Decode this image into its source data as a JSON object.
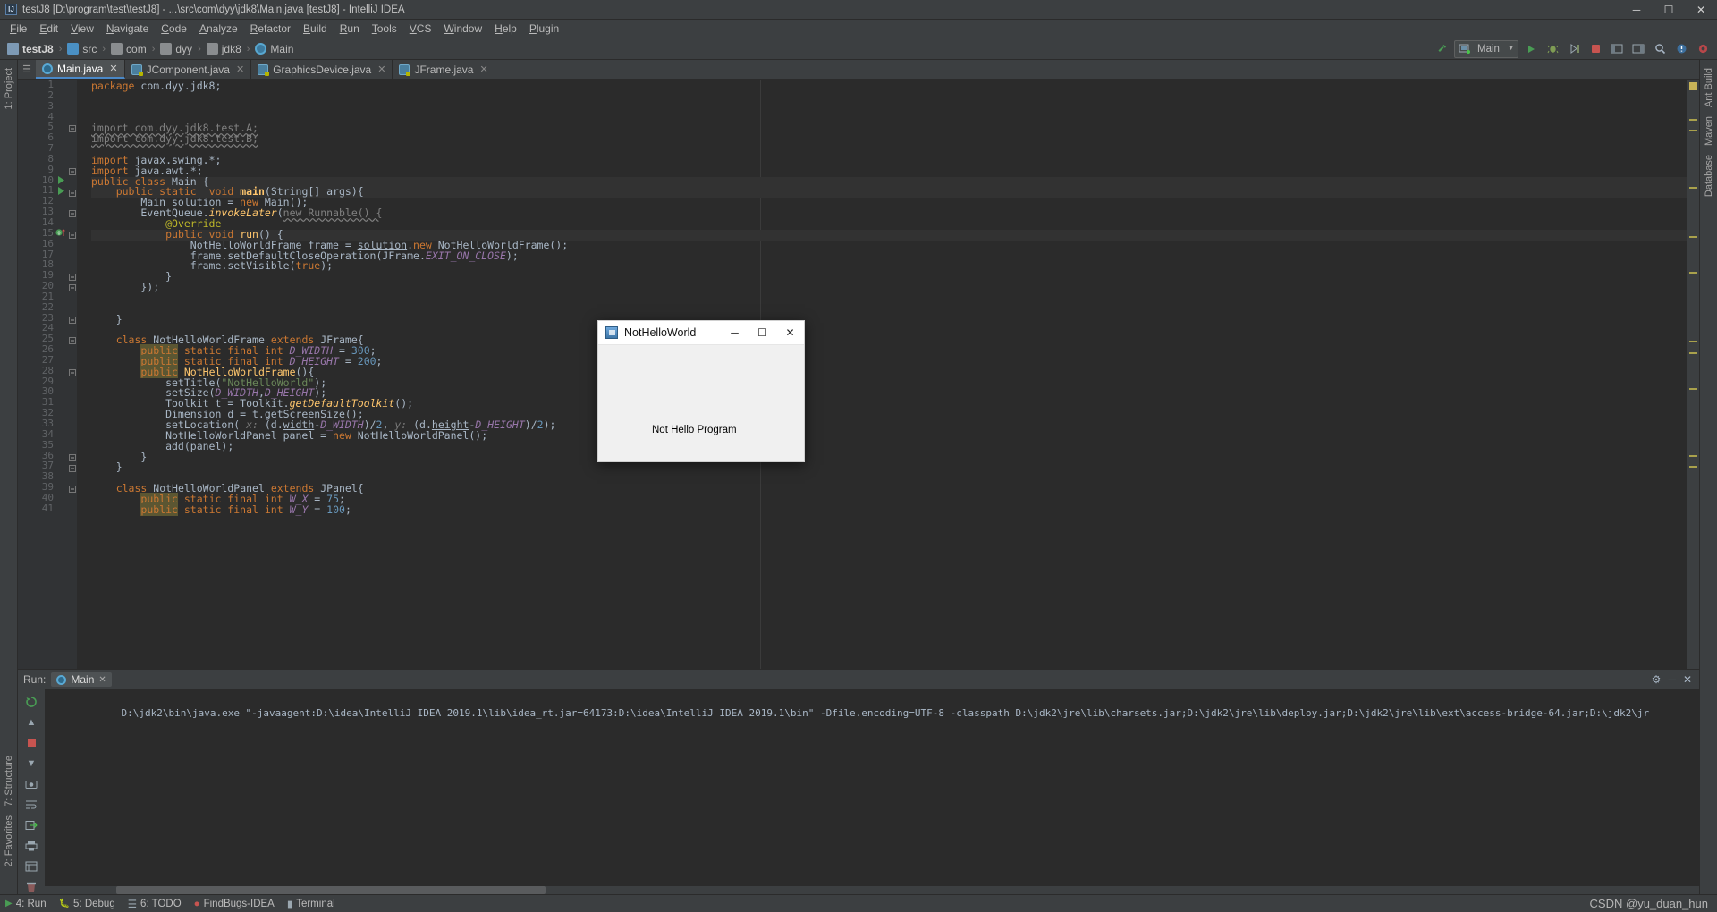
{
  "window": {
    "title": "testJ8 [D:\\program\\test\\testJ8] - ...\\src\\com\\dyy\\jdk8\\Main.java [testJ8] - IntelliJ IDEA",
    "logo": "IJ",
    "minimize": "─",
    "maximize": "☐",
    "close": "✕"
  },
  "menu": [
    "File",
    "Edit",
    "View",
    "Navigate",
    "Code",
    "Analyze",
    "Refactor",
    "Build",
    "Run",
    "Tools",
    "VCS",
    "Window",
    "Help",
    "Plugin"
  ],
  "breadcrumb": [
    {
      "label": "testJ8",
      "icon": "module-icon",
      "bold": true
    },
    {
      "label": "src",
      "icon": "source-folder-icon",
      "bold": false
    },
    {
      "label": "com",
      "icon": "folder-icon",
      "bold": false
    },
    {
      "label": "dyy",
      "icon": "folder-icon",
      "bold": false
    },
    {
      "label": "jdk8",
      "icon": "folder-icon",
      "bold": false
    },
    {
      "label": "Main",
      "icon": "class-icon",
      "bold": false
    }
  ],
  "toolbar": {
    "build_icon": "hammer-icon",
    "run_config": "Main",
    "dropdown_arrow": "▼",
    "run_icon": "▶",
    "debug_icon": "debug-icon",
    "coverage_icon": "coverage-icon",
    "stop_icon": "stop-icon",
    "layout_icon": "layout-icon",
    "updates_icon": "updates-icon",
    "search_icon": "⌕",
    "settings_icon": "⚙"
  },
  "tabs": [
    {
      "label": "Main.java",
      "icon": "java-class-icon",
      "active": true
    },
    {
      "label": "JComponent.java",
      "icon": "java-library-class-icon",
      "active": false
    },
    {
      "label": "GraphicsDevice.java",
      "icon": "java-library-class-icon",
      "active": false
    },
    {
      "label": "JFrame.java",
      "icon": "java-library-class-icon",
      "active": false
    }
  ],
  "left_tool_strip": [
    {
      "label": "1: Project",
      "name": "tool-window-project"
    },
    {
      "label": "7: Structure",
      "name": "tool-window-structure"
    },
    {
      "label": "2: Favorites",
      "name": "tool-window-favorites"
    }
  ],
  "right_tool_strip": [
    {
      "label": "Ant Build",
      "name": "tool-window-ant-build"
    },
    {
      "label": "Maven",
      "name": "tool-window-maven"
    },
    {
      "label": "Database",
      "name": "tool-window-database"
    }
  ],
  "editor": {
    "first_line": 1,
    "total_displayed_lines": 41,
    "code_lines": [
      {
        "n": 1,
        "html": "<span class=\"kw\">package</span> com.dyy.jdk8;"
      },
      {
        "n": 2,
        "html": ""
      },
      {
        "n": 3,
        "html": ""
      },
      {
        "n": 4,
        "html": ""
      },
      {
        "n": 5,
        "html": "<span class=\"err\">import com.dyy.jdk8.test.A;</span>"
      },
      {
        "n": 6,
        "html": "<span class=\"err\">import com.dyy.jdk8.test.B;</span>"
      },
      {
        "n": 7,
        "html": ""
      },
      {
        "n": 8,
        "html": "<span class=\"kw\">import</span> javax.swing.*;"
      },
      {
        "n": 9,
        "html": "<span class=\"kw\">import</span> java.awt.*;"
      },
      {
        "n": 10,
        "html": "<span class=\"kw\">public class</span> <span class=\"cls\">Main</span> {"
      },
      {
        "n": 11,
        "html": "    <span class=\"kw\">public static</span>  <span class=\"kw\">void</span> <span class=\"mth bold\">main</span>(String[] args){"
      },
      {
        "n": 12,
        "html": "        Main solution = <span class=\"kw\">new</span> Main();"
      },
      {
        "n": 13,
        "html": "        EventQueue.<span class=\"mthi\">invokeLater</span>(<span class=\"err\">new Runnable() {</span>"
      },
      {
        "n": 14,
        "html": "            <span class=\"anno\">@Override</span>"
      },
      {
        "n": 15,
        "html": "            <span class=\"kw\">public void</span> <span class=\"mth\">run</span>() {"
      },
      {
        "n": 16,
        "html": "                NotHelloWorldFrame frame = <span class=\"varu\">solution</span>.<span class=\"kw\">new</span> NotHelloWorldFrame();"
      },
      {
        "n": 17,
        "html": "                frame.setDefaultCloseOperation(JFrame.<span class=\"sfld\">EXIT_ON_CLOSE</span>);"
      },
      {
        "n": 18,
        "html": "                frame.setVisible(<span class=\"kw\">true</span>);"
      },
      {
        "n": 19,
        "html": "            }"
      },
      {
        "n": 20,
        "html": "        });"
      },
      {
        "n": 21,
        "html": ""
      },
      {
        "n": 22,
        "html": ""
      },
      {
        "n": 23,
        "html": "    }"
      },
      {
        "n": 24,
        "html": ""
      },
      {
        "n": 25,
        "html": "    <span class=\"kw\">class</span> <span class=\"cls\">NotHelloWorldFrame</span> <span class=\"kw\">extends</span> JFrame{"
      },
      {
        "n": 26,
        "html": "        <span class=\"kw hili\">public</span> <span class=\"kw\">static final int</span> <span class=\"sfld\">D_WIDTH</span> = <span class=\"num\">300</span>;"
      },
      {
        "n": 27,
        "html": "        <span class=\"kw hili\">public</span> <span class=\"kw\">static final int</span> <span class=\"sfld\">D_HEIGHT</span> = <span class=\"num\">200</span>;"
      },
      {
        "n": 28,
        "html": "        <span class=\"kw hili\">public</span> <span class=\"mth\">NotHelloWorldFrame</span>(){"
      },
      {
        "n": 29,
        "html": "            setTitle(<span class=\"str\">\"NotHelloWorld\"</span>);"
      },
      {
        "n": 30,
        "html": "            setSize(<span class=\"sfld\">D_WIDTH</span>,<span class=\"sfld\">D_HEIGHT</span>);"
      },
      {
        "n": 31,
        "html": "            Toolkit t = Toolkit.<span class=\"mthi\">getDefaultToolkit</span>();"
      },
      {
        "n": 32,
        "html": "            Dimension d = t.getScreenSize();"
      },
      {
        "n": 33,
        "html": "            setLocation( <span class=\"hint\">x:</span> (d.<span class=\"varu\">width</span>-<span class=\"sfld\">D_WIDTH</span>)/<span class=\"num\">2</span>, <span class=\"hint\">y:</span> (d.<span class=\"varu\">height</span>-<span class=\"sfld\">D_HEIGHT</span>)/<span class=\"num\">2</span>);"
      },
      {
        "n": 34,
        "html": "            NotHelloWorldPanel panel = <span class=\"kw\">new</span> NotHelloWorldPanel();"
      },
      {
        "n": 35,
        "html": "            add(panel);"
      },
      {
        "n": 36,
        "html": "        }"
      },
      {
        "n": 37,
        "html": "    }"
      },
      {
        "n": 38,
        "html": ""
      },
      {
        "n": 39,
        "html": "    <span class=\"kw\">class</span> <span class=\"cls\">NotHelloWorldPanel</span> <span class=\"kw\">extends</span> JPanel{"
      },
      {
        "n": 40,
        "html": "        <span class=\"kw hili\">public</span> <span class=\"kw\">static final int</span> <span class=\"sfld\">W_X</span> = <span class=\"num\">75</span>;"
      },
      {
        "n": 41,
        "html": "        <span class=\"kw hili\">public</span> <span class=\"kw\">static final int</span> <span class=\"sfld\">W_Y</span> = <span class=\"num\">100</span>;"
      }
    ],
    "run_gutter_lines": [
      10,
      11
    ],
    "breakpoint_lines": [
      15
    ],
    "fold_lines": [
      5,
      9,
      11,
      13,
      15,
      19,
      20,
      23,
      25,
      28,
      36,
      37,
      39
    ]
  },
  "swing_window": {
    "title": "NotHelloWorld",
    "icon": "java-duke-icon",
    "minimize": "─",
    "maximize": "☐",
    "close": "✕",
    "content_text": "Not Hello Program"
  },
  "run_window": {
    "run_label": "Run:",
    "tab_label": "Main",
    "tab_close": "✕",
    "settings_icon": "⚙",
    "minimize_icon": "─",
    "close_icon": "✕",
    "console_output": "D:\\jdk2\\bin\\java.exe \"-javaagent:D:\\idea\\IntelliJ IDEA 2019.1\\lib\\idea_rt.jar=64173:D:\\idea\\IntelliJ IDEA 2019.1\\bin\" -Dfile.encoding=UTF-8 -classpath D:\\jdk2\\jre\\lib\\charsets.jar;D:\\jdk2\\jre\\lib\\deploy.jar;D:\\jdk2\\jre\\lib\\ext\\access-bridge-64.jar;D:\\jdk2\\jr",
    "side_icons": [
      "rerun-icon",
      "scroll-up-icon",
      "stop-icon",
      "scroll-down-icon",
      "camera-icon",
      "print-icon",
      "wrap-icon",
      "export-icon",
      "soft-wrap-icon",
      "clear-all-icon"
    ]
  },
  "statusbar": {
    "items": [
      {
        "label": "4: Run",
        "icon": "run-icon",
        "name": "status-run"
      },
      {
        "label": "5: Debug",
        "icon": "debug-icon",
        "name": "status-debug"
      },
      {
        "label": "6: TODO",
        "icon": "todo-icon",
        "name": "status-todo"
      },
      {
        "label": "FindBugs-IDEA",
        "icon": "findbugs-icon",
        "name": "status-findbugs"
      },
      {
        "label": "Terminal",
        "icon": "terminal-icon",
        "name": "status-terminal"
      }
    ],
    "watermark": "CSDN @yu_duan_hun"
  },
  "colors": {
    "ide_background": "#3c3f41",
    "editor_background": "#2b2b2b",
    "accent_blue": "#4a88c7",
    "keyword_orange": "#cc7832",
    "string_green": "#6a8759",
    "number_blue": "#6897bb",
    "field_purple": "#9876aa",
    "method_yellow": "#ffc66d",
    "run_green": "#499c54",
    "stop_red": "#c75450"
  }
}
